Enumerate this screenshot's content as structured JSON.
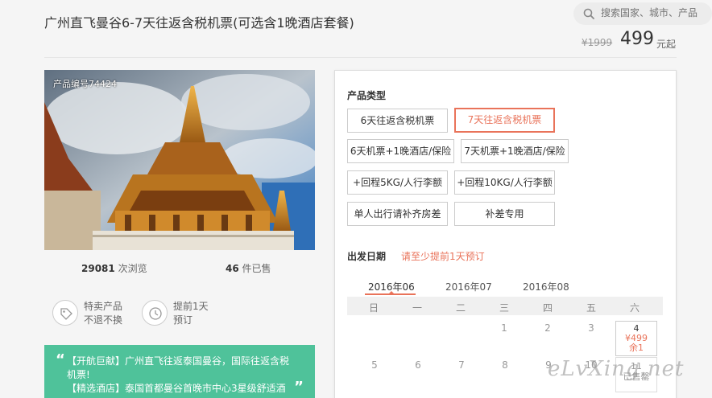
{
  "header": {
    "title": "广州直飞曼谷6-7天往返含税机票(可选含1晚酒店套餐)",
    "search_placeholder": "搜索国家、城市、产品",
    "price_old": "¥1999",
    "price_now": "499",
    "price_unit": "元起"
  },
  "product": {
    "number_label": "产品编号74424",
    "views_count": "29081",
    "views_label": "次浏览",
    "sold_count": "46",
    "sold_label": "件已售"
  },
  "features": [
    {
      "icon": "tag-icon",
      "line1": "特卖产品",
      "line2": "不退不换"
    },
    {
      "icon": "clock-icon",
      "line1": "提前1天",
      "line2": "预订"
    }
  ],
  "promo": {
    "line1": "【开航巨献】广州直飞往返泰国曼谷，国际往返含税",
    "line2": "机票!",
    "line3": "【精选酒店】泰国首都曼谷首晚市中心3星级舒适酒"
  },
  "booking": {
    "type_label": "产品类型",
    "options": [
      {
        "label": "6天往返含税机票",
        "selected": false
      },
      {
        "label": "7天往返含税机票",
        "selected": true
      },
      {
        "label": "6天机票+1晚酒店/保险",
        "selected": false
      },
      {
        "label": "7天机票+1晚酒店/保险",
        "selected": false
      },
      {
        "label": "+回程5KG/人行李额",
        "selected": false
      },
      {
        "label": "+回程10KG/人行李额",
        "selected": false
      },
      {
        "label": "单人出行请补齐房差",
        "selected": false
      },
      {
        "label": "补差专用",
        "selected": false
      }
    ],
    "departure_label": "出发日期",
    "departure_note": "请至少提前1天预订"
  },
  "calendar": {
    "months": [
      "2016年06",
      "2016年07",
      "2016年08"
    ],
    "active_month": "2016年06",
    "weekdays": [
      "日",
      "一",
      "二",
      "三",
      "四",
      "五",
      "六"
    ],
    "row1": [
      "1",
      "2",
      "3"
    ],
    "highlight": {
      "day": "4",
      "price": "¥499",
      "remaining": "余1"
    },
    "row2": [
      "5",
      "6",
      "7",
      "8",
      "9",
      "10"
    ],
    "soldout": {
      "day": "11",
      "status": "已售罄"
    }
  },
  "watermark": "eLvXing.net",
  "colors": {
    "accent": "#e9735a",
    "promo_bg": "#4fc29a",
    "page_bg": "#f5f5f5"
  }
}
